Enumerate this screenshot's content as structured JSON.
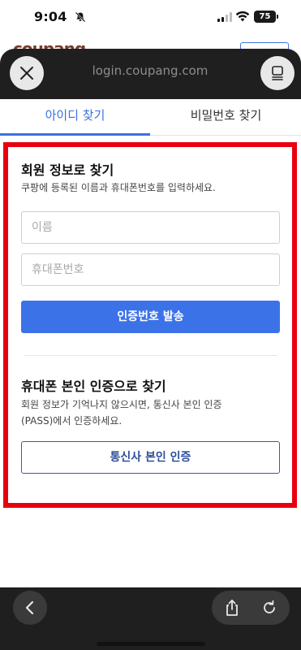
{
  "status_bar": {
    "time": "9:04",
    "battery": "75"
  },
  "background_page": {
    "logo": "coupang"
  },
  "browser": {
    "url": "login.coupang.com",
    "close_icon": "close-icon",
    "reader_icon": "reader-mode-icon"
  },
  "tabs": [
    {
      "label": "아이디 찾기",
      "active": true
    },
    {
      "label": "비밀번호 찾기",
      "active": false
    }
  ],
  "member_info": {
    "title": "회원 정보로 찾기",
    "description": "쿠팡에 등록된 이름과 휴대폰번호를 입력하세요.",
    "name_placeholder": "이름",
    "phone_placeholder": "휴대폰번호",
    "submit_label": "인증번호 발송"
  },
  "phone_auth": {
    "title": "휴대폰 본인 인증으로 찾기",
    "description_line1": "회원 정보가 기억나지 않으시면, 통신사 본인 인증",
    "description_line2": "(PASS)에서 인증하세요.",
    "button_label": "통신사 본인 인증"
  },
  "toolbar": {
    "back_icon": "chevron-left-icon",
    "share_icon": "share-icon",
    "reload_icon": "reload-icon"
  },
  "colors": {
    "accent": "#3c72e8",
    "highlight": "#e80010",
    "dark": "#1f1f1f"
  }
}
